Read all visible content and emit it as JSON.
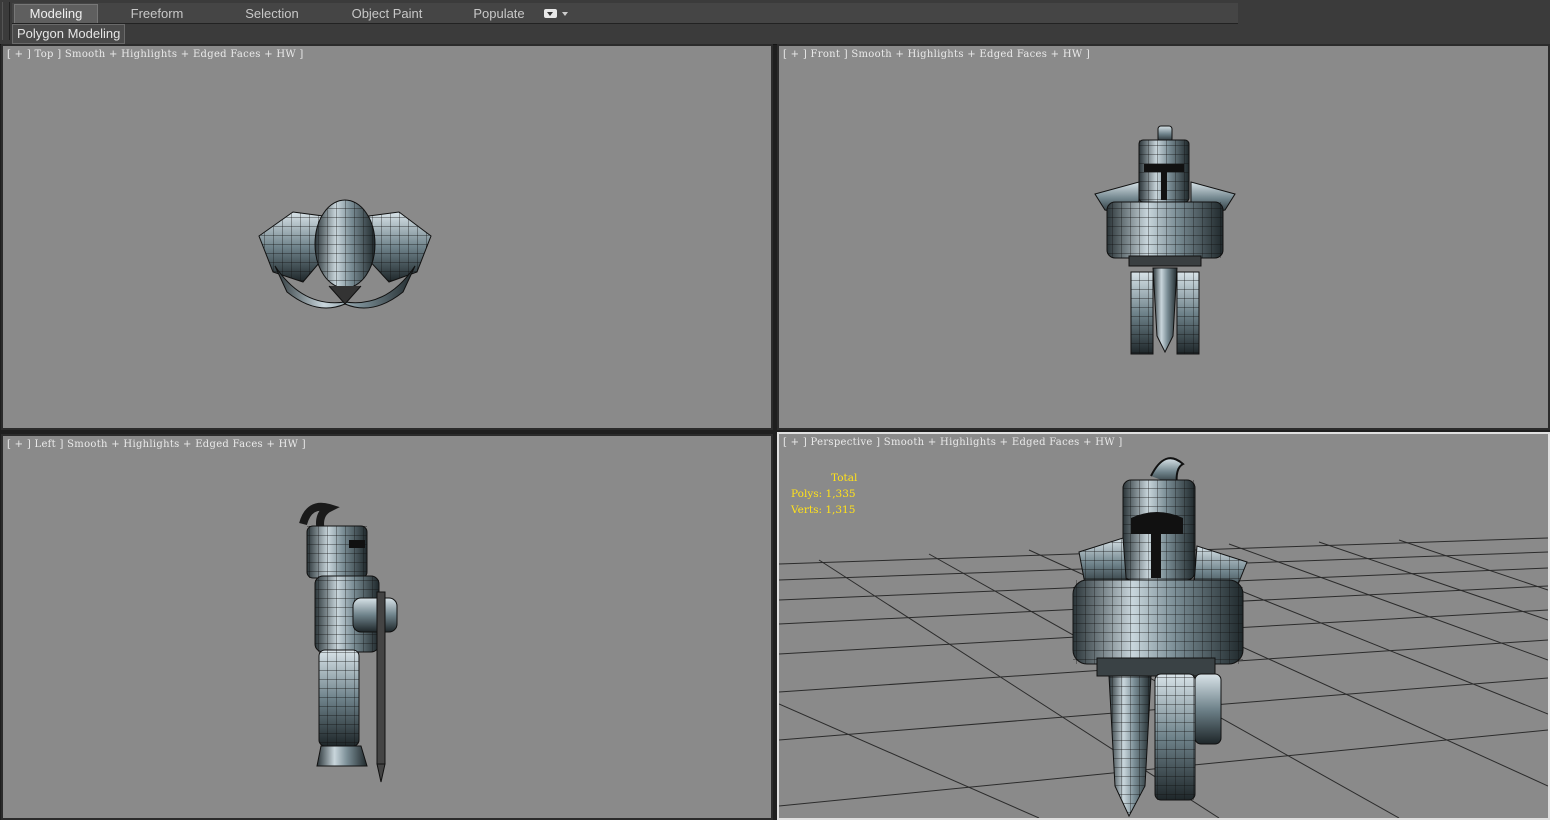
{
  "ribbon": {
    "tabs": [
      {
        "label": "Modeling",
        "active": true
      },
      {
        "label": "Freeform",
        "active": false
      },
      {
        "label": "Selection",
        "active": false
      },
      {
        "label": "Object Paint",
        "active": false
      },
      {
        "label": "Populate",
        "active": false
      }
    ],
    "options_icon": "dropdown-options-icon",
    "panel_label": "Polygon Modeling"
  },
  "viewports": {
    "top": {
      "label": "[ + ] Top ] Smooth + Highlights + Edged Faces + HW ]"
    },
    "front": {
      "label": "[ + ] Front ] Smooth + Highlights + Edged Faces + HW ]"
    },
    "left": {
      "label": "[ + ] Left ] Smooth + Highlights + Edged Faces + HW ]"
    },
    "perspective": {
      "label": "[ + ] Perspective ] Smooth + Highlights + Edged Faces + HW ]"
    }
  },
  "stats": {
    "title": "Total",
    "polys": "Polys: 1,335",
    "verts": "Verts: 1,315"
  },
  "colors": {
    "viewport_bg": "#8a8a8a",
    "active_border": "#e0e0e0",
    "stats_text": "#ffe11a",
    "ribbon_bg": "#3b3b3b"
  }
}
